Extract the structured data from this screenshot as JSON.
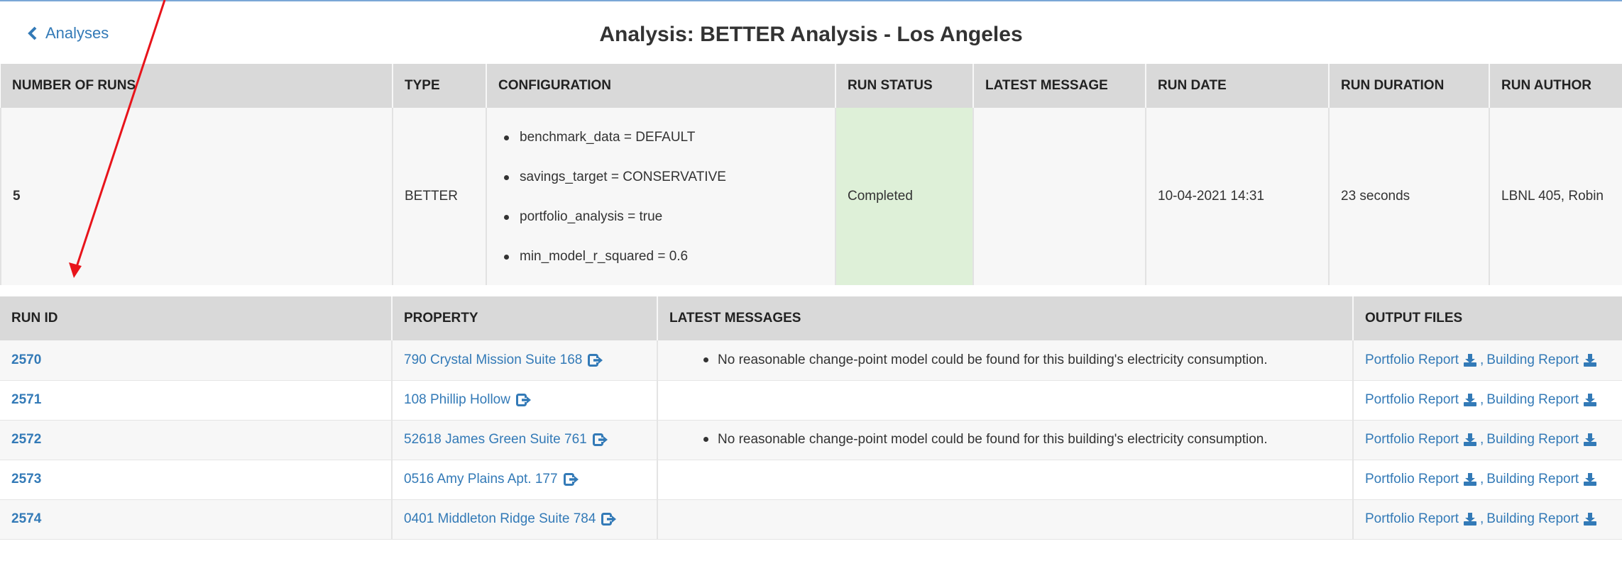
{
  "header": {
    "back_label": "Analyses",
    "title": "Analysis: BETTER Analysis - Los Angeles"
  },
  "summary": {
    "columns": [
      "NUMBER OF RUNS",
      "TYPE",
      "CONFIGURATION",
      "RUN STATUS",
      "LATEST MESSAGE",
      "RUN DATE",
      "RUN DURATION",
      "RUN AUTHOR"
    ],
    "row": {
      "number_of_runs": "5",
      "type": "BETTER",
      "configuration": [
        "benchmark_data = DEFAULT",
        "savings_target = CONSERVATIVE",
        "portfolio_analysis = true",
        "min_model_r_squared = 0.6"
      ],
      "run_status": "Completed",
      "latest_message": "",
      "run_date": "10-04-2021 14:31",
      "run_duration": "23 seconds",
      "run_author": "LBNL 405, Robin"
    }
  },
  "runs": {
    "columns": [
      "RUN ID",
      "PROPERTY",
      "LATEST MESSAGES",
      "OUTPUT FILES"
    ],
    "rows": [
      {
        "id": "2570",
        "property": "790 Crystal Mission Suite 168",
        "message": "No reasonable change-point model could be found for this building's electricity consumption."
      },
      {
        "id": "2571",
        "property": "108 Phillip Hollow",
        "message": ""
      },
      {
        "id": "2572",
        "property": "52618 James Green Suite 761",
        "message": "No reasonable change-point model could be found for this building's electricity consumption."
      },
      {
        "id": "2573",
        "property": "0516 Amy Plains Apt. 177",
        "message": ""
      },
      {
        "id": "2574",
        "property": "0401 Middleton Ridge Suite 784",
        "message": ""
      }
    ],
    "file_labels": {
      "portfolio": "Portfolio Report",
      "building": "Building Report",
      "separator": ","
    }
  },
  "colors": {
    "link": "#337ab7",
    "header_bg": "#d9d9d9",
    "status_completed": "#def0d8",
    "annotation_arrow": "#e8141b"
  },
  "icons": {
    "back": "chevron-left-icon",
    "property_link": "external-link-icon",
    "download": "download-icon"
  }
}
